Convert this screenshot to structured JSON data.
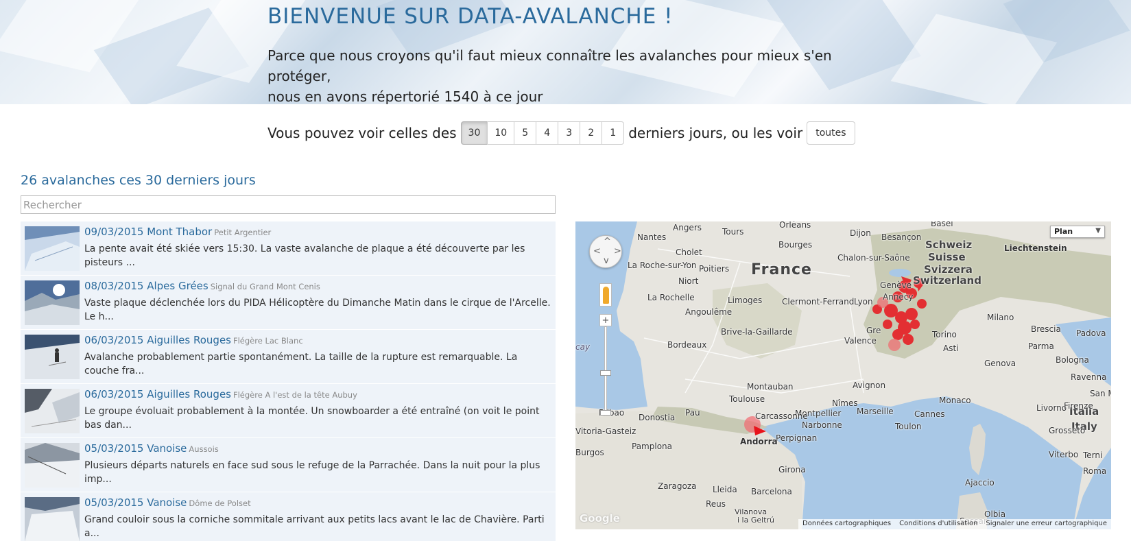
{
  "banner": {
    "title": "BIENVENUE SUR DATA-AVALANCHE !",
    "intro_line1": "Parce que nous croyons qu'il faut mieux connaître les avalanches pour mieux s'en protéger,",
    "intro_line2": "nous en avons répertorié 1540 à ce jour"
  },
  "filter": {
    "prefix": "Vous pouvez voir celles des",
    "days": [
      "30",
      "10",
      "5",
      "4",
      "3",
      "2",
      "1"
    ],
    "active_day": "30",
    "middle": "derniers jours, ou les voir",
    "all_label": "toutes"
  },
  "list": {
    "heading": "26 avalanches ces 30 derniers jours",
    "search_placeholder": "Rechercher",
    "items": [
      {
        "title": "09/03/2015 Mont Thabor",
        "place": "Petit Argentier",
        "desc": "La pente avait été skiée vers 15:30. La vaste avalanche de plaque a été découverte par les pisteurs ..."
      },
      {
        "title": "08/03/2015 Alpes Grées",
        "place": "Signal du Grand Mont Cenis",
        "desc": "Vaste plaque déclenchée lors du PIDA Hélicoptère du Dimanche Matin dans le cirque de l'Arcelle. Le h..."
      },
      {
        "title": "06/03/2015 Aiguilles Rouges",
        "place": "Flégère Lac Blanc",
        "desc": "Avalanche probablement partie spontanément. La taille de la rupture est remarquable. La couche fra..."
      },
      {
        "title": "06/03/2015 Aiguilles Rouges",
        "place": "Flégère A l'est de la tête Aubuy",
        "desc": "Le groupe évoluait probablement à la montée. Un snowboarder a été entraîné (on voit le point bas dan..."
      },
      {
        "title": "05/03/2015 Vanoise",
        "place": "Aussois",
        "desc": "Plusieurs départs naturels en face sud sous le refuge de la Parrachée. Dans la nuit pour la plus imp..."
      },
      {
        "title": "05/03/2015 Vanoise",
        "place": "Dôme de Polset",
        "desc": "Grand couloir sous la corniche sommitale arrivant aux petits lacs avant le lac de Chavière. Parti a..."
      }
    ]
  },
  "map": {
    "map_type": "Plan",
    "logo": "Google",
    "footer": [
      "Données cartographiques",
      "Conditions d'utilisation",
      "Signaler une erreur cartographique"
    ],
    "labels": {
      "france": "France",
      "schweiz": "Schweiz",
      "suisse": "Suisse",
      "svizzera": "Svizzera",
      "switzerland": "Switzerland",
      "italia": "Italia",
      "italy": "Italy",
      "liechtenstein": "Liechtenstein",
      "nantes": "Nantes",
      "angers": "Angers",
      "tours": "Tours",
      "orleans": "Orléans",
      "dijon": "Dijon",
      "besancon": "Besançon",
      "basel": "Basel",
      "cholet": "Cholet",
      "bourges": "Bourges",
      "chalon": "Chalon-sur-Saône",
      "laroche": "La Roche-sur-Yon",
      "poitiers": "Poitiers",
      "niort": "Niort",
      "larochelle": "La Rochelle",
      "limoges": "Limoges",
      "clermont": "Clermont-Ferrand",
      "lyon": "Lyon",
      "geneve": "Genève",
      "annecy": "Annecy",
      "angouleme": "Angoulême",
      "milano": "Milano",
      "brescia": "Brescia",
      "padova": "Padova",
      "torino": "Torino",
      "brive": "Brive-la-Gaillarde",
      "valence": "Valence",
      "grenoble": "Gre",
      "bordeaux": "Bordeaux",
      "asti": "Asti",
      "parma": "Parma",
      "bologna": "Bologna",
      "genova": "Genova",
      "ravenna": "Ravenna",
      "avignon": "Avignon",
      "montauban": "Montauban",
      "nimes": "Nîmes",
      "monaco": "Monaco",
      "sanmarino": "San Marino",
      "toulouse": "Toulouse",
      "montpellier": "Montpellier",
      "marseille": "Marseille",
      "cannes": "Cannes",
      "bilbao": "Bilbao",
      "donostia": "Donostia",
      "pau": "Pau",
      "carcassonne": "Carcassonne",
      "narbonne": "Narbonne",
      "toulon": "Toulon",
      "livorno": "Livorno",
      "firenze": "Firenze",
      "vitoria": "Vitoria-Gasteiz",
      "perpignan": "Perpignan",
      "andorra": "Andorra",
      "grosseto": "Grosseto",
      "burgos": "Burgos",
      "pamplona": "Pamplona",
      "viterbo": "Viterbo",
      "terni": "Terni",
      "girona": "Girona",
      "roma": "Roma",
      "zaragoza": "Zaragoza",
      "lleida": "Lleida",
      "barcelona": "Barcelona",
      "ajaccio": "Ajaccio",
      "reus": "Reus",
      "vilanova": "Vilanova",
      "vilanova2": "i la Geltrú",
      "sassari": "Sassari",
      "olbia": "Olbia",
      "biscay": "cay"
    }
  }
}
